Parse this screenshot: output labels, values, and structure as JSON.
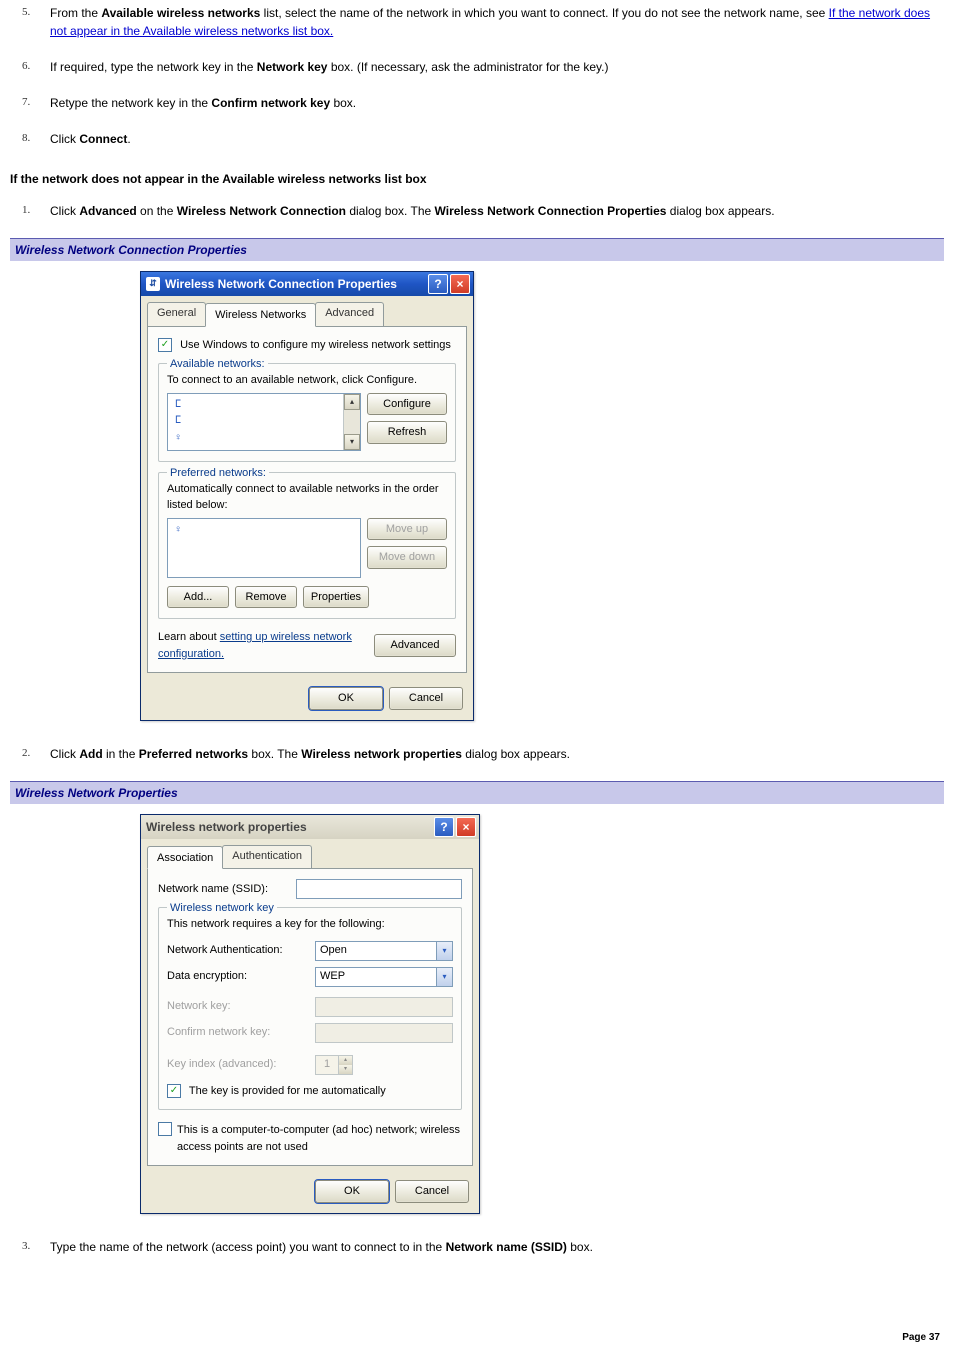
{
  "steps_first": [
    {
      "num": "5",
      "pre": "From the ",
      "b1": "Available wireless networks",
      "mid1": " list, select the name of the network in which you want to connect. If you do not see the network name, see ",
      "link": "If the network does not appear in the Available wireless networks list box."
    },
    {
      "num": "6",
      "pre": "If required, type the network key in the ",
      "b1": "Network key",
      "mid1": " box. (If necessary, ask the administrator for the key.)"
    },
    {
      "num": "7",
      "pre": "Retype the network key in the ",
      "b1": "Confirm network key",
      "mid1": " box."
    },
    {
      "num": "8",
      "pre": "Click ",
      "b1": "Connect",
      "mid1": "."
    }
  ],
  "heading_not_appear": "If the network does not appear in the Available wireless networks list box",
  "steps_notappear_1": {
    "num": "1",
    "pre": "Click ",
    "b1": "Advanced",
    "mid1": " on the ",
    "b2": "Wireless Network Connection",
    "mid2": " dialog box. The ",
    "b3": "Wireless Network Connection Properties",
    "mid3": " dialog box appears."
  },
  "caption1": "Wireless Network Connection Properties",
  "dlg1": {
    "title": "Wireless Network Connection Properties",
    "tabs": {
      "general": "General",
      "wireless": "Wireless Networks",
      "advanced": "Advanced"
    },
    "use_windows": "Use Windows to configure my wireless network settings",
    "avail_title": "Available networks:",
    "avail_hint": "To connect to an available network, click Configure.",
    "btn_configure": "Configure",
    "btn_refresh": "Refresh",
    "pref_title": "Preferred networks:",
    "pref_hint": "Automatically connect to available networks in the order listed below:",
    "btn_moveup": "Move up",
    "btn_movedown": "Move down",
    "btn_add": "Add...",
    "btn_remove": "Remove",
    "btn_properties": "Properties",
    "learn_pre": "Learn about ",
    "learn_link": "setting up wireless network configuration.",
    "btn_advanced": "Advanced",
    "btn_ok": "OK",
    "btn_cancel": "Cancel"
  },
  "steps_notappear_2": {
    "num": "2",
    "pre": "Click ",
    "b1": "Add",
    "mid1": " in the ",
    "b2": "Preferred networks",
    "mid2": " box. The ",
    "b3": "Wireless network properties",
    "mid3": " dialog box appears."
  },
  "caption2": "Wireless Network Properties",
  "dlg2": {
    "title": "Wireless network properties",
    "tabs": {
      "assoc": "Association",
      "auth": "Authentication"
    },
    "ssid_label": "Network name (SSID):",
    "key_group": "Wireless network key",
    "key_hint": "This network requires a key for the following:",
    "na_label": "Network Authentication:",
    "na_value": "Open",
    "de_label": "Data encryption:",
    "de_value": "WEP",
    "nk_label": "Network key:",
    "cnk_label": "Confirm network key:",
    "ki_label": "Key index (advanced):",
    "ki_value": "1",
    "auto_label": "The key is provided for me automatically",
    "adhoc_label": "This is a computer-to-computer (ad hoc) network; wireless access points are not used",
    "btn_ok": "OK",
    "btn_cancel": "Cancel"
  },
  "steps_notappear_3": {
    "num": "3",
    "pre": "Type the name of the network (access point) you want to connect to in the ",
    "b1": "Network name (SSID)",
    "mid1": " box."
  },
  "page_label": "Page 37"
}
